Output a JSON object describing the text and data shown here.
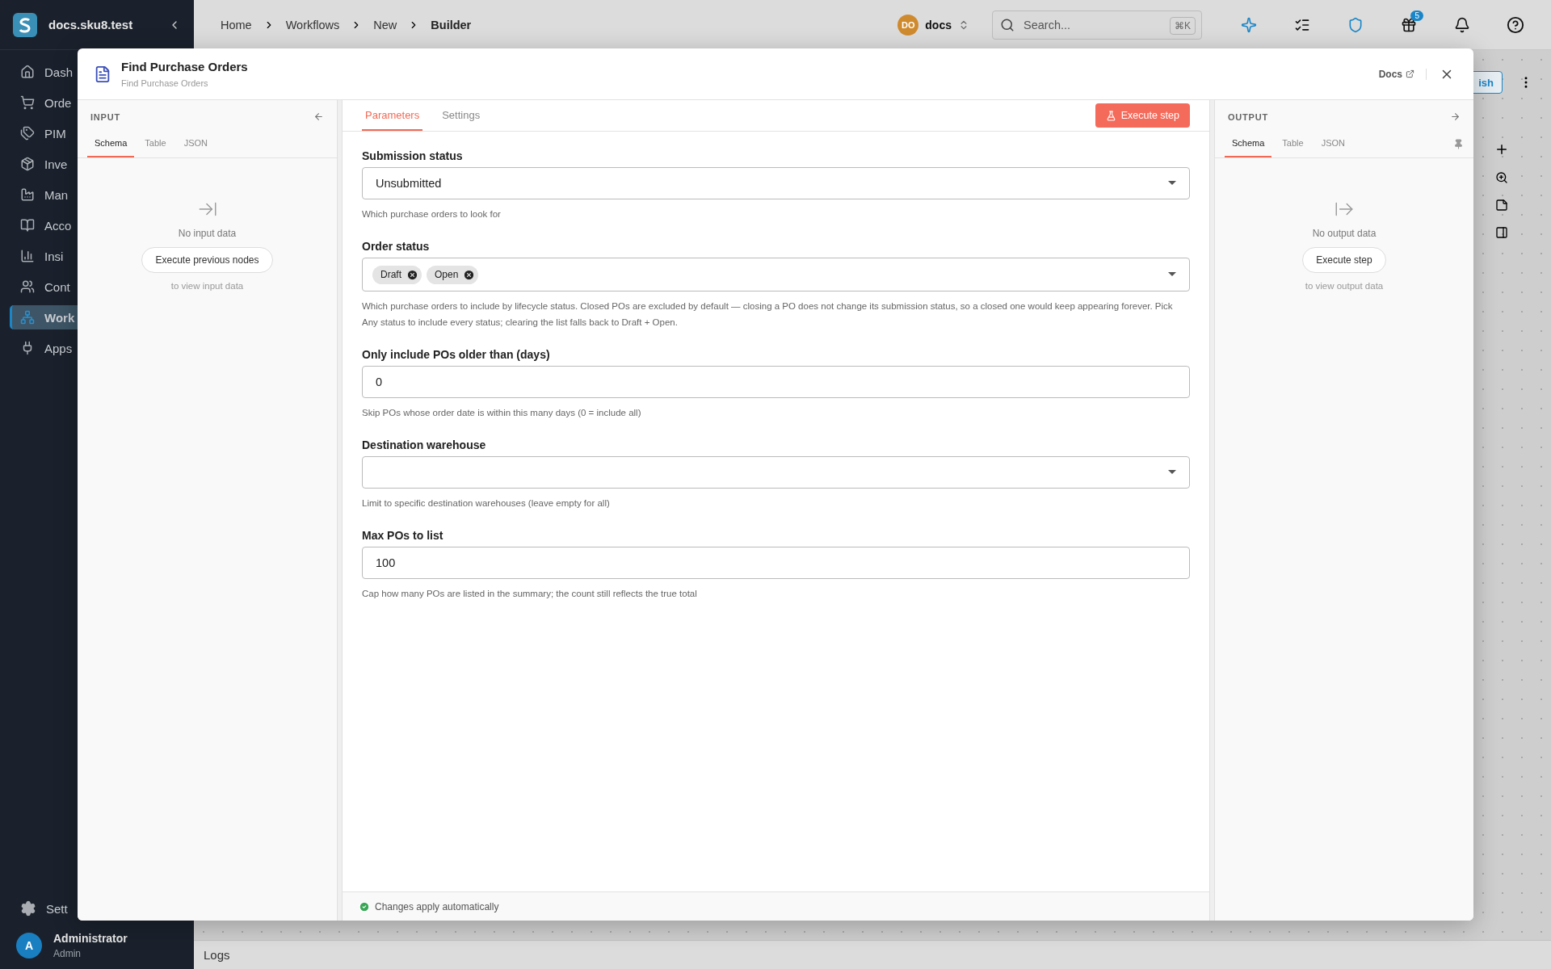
{
  "app": {
    "workspace": "docs.sku8.test",
    "nav": [
      {
        "kind": "home",
        "label": "Dash",
        "selected": false
      },
      {
        "kind": "cart",
        "label": "Orde",
        "selected": false
      },
      {
        "kind": "tag",
        "label": "PIM",
        "selected": false
      },
      {
        "kind": "box",
        "label": "Inve",
        "selected": false
      },
      {
        "kind": "factory",
        "label": "Man",
        "selected": false
      },
      {
        "kind": "book",
        "label": "Acco",
        "selected": false
      },
      {
        "kind": "chart",
        "label": "Insi",
        "selected": false
      },
      {
        "kind": "people",
        "label": "Cont",
        "selected": false
      },
      {
        "kind": "flow",
        "label": "Work",
        "selected": true
      },
      {
        "kind": "plug",
        "label": "Apps",
        "selected": false
      }
    ],
    "settings": "Sett",
    "user": {
      "initial": "A",
      "name": "Administrator",
      "role": "Admin"
    }
  },
  "breadcrumbs": [
    "Home",
    "Workflows",
    "New",
    "Builder"
  ],
  "org": {
    "initials": "DO",
    "name": "docs"
  },
  "search": {
    "placeholder": "Search...",
    "shortcut": "⌘K"
  },
  "gift_badge": "5",
  "publish_button": "ish",
  "logs": "Logs",
  "dialog": {
    "title": "Find Purchase Orders",
    "subtitle": "Find Purchase Orders",
    "docs_link": "Docs",
    "input": {
      "heading": "INPUT",
      "tabs": [
        {
          "label": "Schema",
          "selected": true
        },
        {
          "label": "Table",
          "selected": false
        },
        {
          "label": "JSON",
          "selected": false
        }
      ],
      "empty": "No input data",
      "button": "Execute previous nodes",
      "hint": "to view input data"
    },
    "tabs": [
      {
        "label": "Parameters",
        "selected": true
      },
      {
        "label": "Settings",
        "selected": false
      }
    ],
    "execute_button": "Execute step",
    "fields": [
      {
        "kind": "select",
        "label": "Submission status",
        "value": "Unsubmitted",
        "help": "Which purchase orders to look for"
      },
      {
        "kind": "multiselect",
        "label": "Order status",
        "chips": [
          "Draft",
          "Open"
        ],
        "help": "Which purchase orders to include by lifecycle status. Closed POs are excluded by default — closing a PO does not change its submission status, so a closed one would keep appearing forever. Pick Any status to include every status; clearing the list falls back to Draft + Open."
      },
      {
        "kind": "text",
        "label": "Only include POs older than (days)",
        "value": "0",
        "help": "Skip POs whose order date is within this many days (0 = include all)"
      },
      {
        "kind": "select",
        "label": "Destination warehouse",
        "help": "Limit to specific destination warehouses (leave empty for all)"
      },
      {
        "kind": "text",
        "label": "Max POs to list",
        "value": "100",
        "help": "Cap how many POs are listed in the summary; the count still reflects the true total"
      }
    ],
    "status": "Changes apply automatically",
    "output": {
      "heading": "OUTPUT",
      "tabs": [
        {
          "label": "Schema",
          "selected": true
        },
        {
          "label": "Table",
          "selected": false
        },
        {
          "label": "JSON",
          "selected": false
        }
      ],
      "empty": "No output data",
      "button": "Execute step",
      "hint": "to view output data"
    }
  }
}
